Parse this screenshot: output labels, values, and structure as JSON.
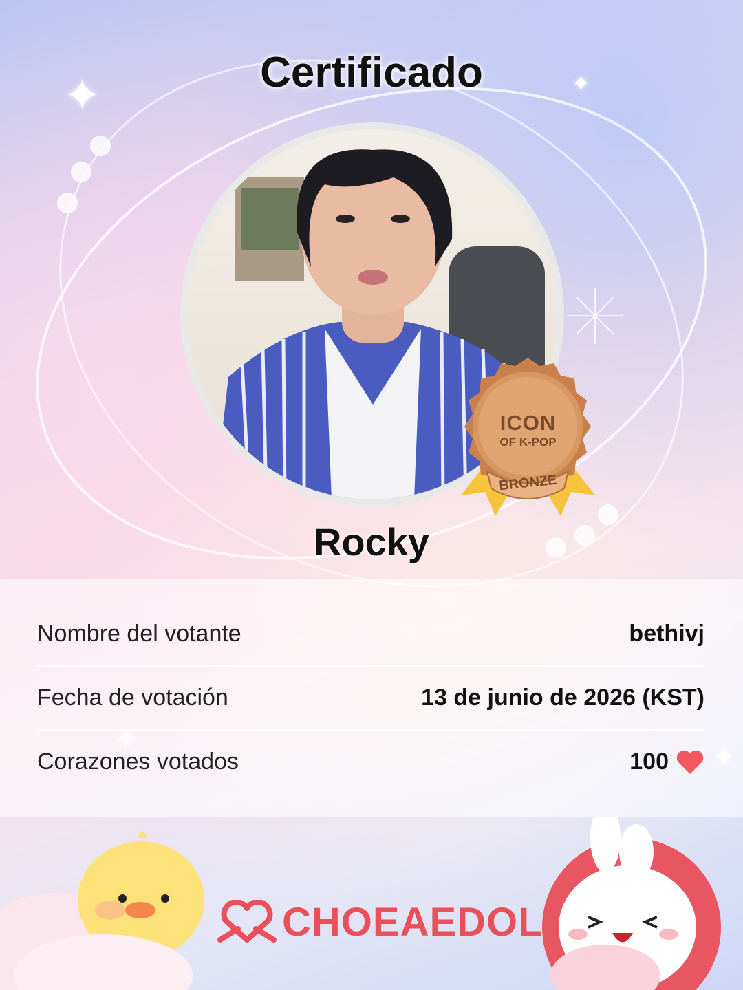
{
  "title": "Certificado",
  "idol": {
    "name": "Rocky"
  },
  "medal": {
    "line1": "ICON",
    "line2": "OF K-POP",
    "tier": "BRONZE"
  },
  "info": {
    "voter_label": "Nombre del votante",
    "voter_value": "bethivj",
    "date_label": "Fecha de votación",
    "date_value": "13 de junio de 2026 (KST)",
    "hearts_label": "Corazones votados",
    "hearts_value": "100"
  },
  "brand": {
    "name": "CHOEAEDOL"
  },
  "icons": {
    "heart": "heart-icon",
    "logo": "choeaedol-logo-icon",
    "moon": "moon-icon",
    "sparkle": "sparkle-icon"
  },
  "colors": {
    "brand_red": "#e9505a",
    "bronze": "#c8814a",
    "ribbon": "#f6c43c"
  }
}
